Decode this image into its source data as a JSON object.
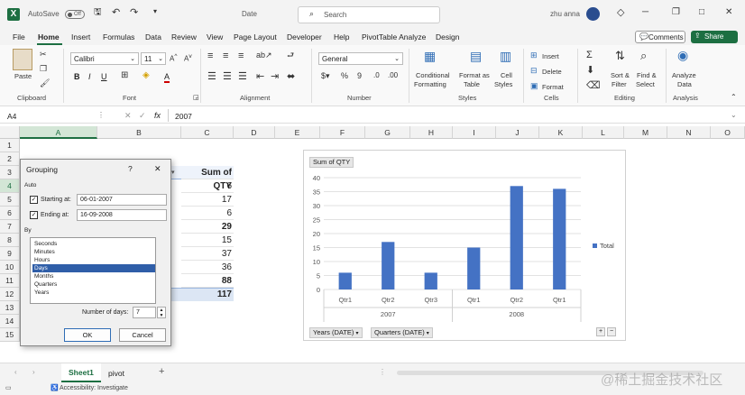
{
  "app": {
    "autosave_label": "AutoSave",
    "autosave_state": "Off",
    "file_name": "Date",
    "search_placeholder": "Search",
    "user_name": "zhu anna"
  },
  "menu": [
    "File",
    "Home",
    "Insert",
    "Formulas",
    "Data",
    "Review",
    "View",
    "Page Layout",
    "Developer",
    "Help",
    "PivotTable Analyze",
    "Design"
  ],
  "menu_active": "Home",
  "actions": {
    "comments": "Comments",
    "share": "Share"
  },
  "ribbon": {
    "clipboard": {
      "paste": "Paste",
      "label": "Clipboard"
    },
    "font": {
      "name": "Calibri",
      "size": "11",
      "label": "Font"
    },
    "alignment": {
      "label": "Alignment"
    },
    "number": {
      "format": "General",
      "label": "Number"
    },
    "styles": {
      "conditional": [
        "Conditional",
        "Formatting"
      ],
      "format_table": [
        "Format as",
        "Table"
      ],
      "cell_styles": [
        "Cell",
        "Styles"
      ],
      "label": "Styles"
    },
    "cells": {
      "insert": "Insert",
      "delete": "Delete",
      "format": "Format",
      "label": "Cells"
    },
    "editing": {
      "sort": [
        "Sort &",
        "Filter"
      ],
      "find": [
        "Find &",
        "Select"
      ],
      "label": "Editing"
    },
    "analysis": {
      "analyze": [
        "Analyze",
        "Data"
      ],
      "label": "Analysis"
    }
  },
  "formula_bar": {
    "name_box": "A4",
    "fx": "fx",
    "value": "2007"
  },
  "columns": [
    "A",
    "B",
    "C",
    "D",
    "E",
    "F",
    "G",
    "H",
    "I",
    "J",
    "K",
    "L",
    "M",
    "N",
    "O"
  ],
  "rows": [
    "1",
    "2",
    "3",
    "4",
    "5",
    "6",
    "7",
    "8",
    "9",
    "10",
    "11",
    "12",
    "13",
    "14",
    "15"
  ],
  "sheet": {
    "header_c3": "Sum of QTY",
    "col_c": [
      {
        "v": "6",
        "b": false
      },
      {
        "v": "17",
        "b": false
      },
      {
        "v": "6",
        "b": false
      },
      {
        "v": "29",
        "b": true
      },
      {
        "v": "15",
        "b": false
      },
      {
        "v": "37",
        "b": false
      },
      {
        "v": "36",
        "b": false
      },
      {
        "v": "88",
        "b": true
      },
      {
        "v": "117",
        "b": true
      }
    ]
  },
  "dialog": {
    "title": "Grouping",
    "help": "?",
    "close": "✕",
    "auto_label": "Auto",
    "starting_label": "Starting at:",
    "starting_value": "06-01-2007",
    "ending_label": "Ending at:",
    "ending_value": "16-09-2008",
    "by_label": "By",
    "by_items": [
      "Seconds",
      "Minutes",
      "Hours",
      "Days",
      "Months",
      "Quarters",
      "Years"
    ],
    "by_selected": "Days",
    "days_label": "Number of days:",
    "days_value": "7",
    "ok": "OK",
    "cancel": "Cancel"
  },
  "chart_data": {
    "type": "bar",
    "title": "Sum of QTY",
    "categories": [
      "Qtr1",
      "Qtr2",
      "Qtr3",
      "Qtr1",
      "Qtr2",
      "Qtr1"
    ],
    "groups": [
      {
        "label": "2007",
        "span": 3
      },
      {
        "label": "2008",
        "span": 3
      }
    ],
    "series": [
      {
        "name": "Total",
        "values": [
          6,
          17,
          6,
          15,
          37,
          36
        ]
      }
    ],
    "yticks": [
      0,
      5,
      10,
      15,
      20,
      25,
      30,
      35,
      40
    ],
    "ylim": [
      0,
      40
    ],
    "legend": "right",
    "bar_color": "#4472c4",
    "field_buttons": [
      "Years (DATE)",
      "Quarters (DATE)"
    ]
  },
  "tabs": {
    "sheets": [
      "Sheet1",
      "pivot"
    ],
    "active": "Sheet1",
    "add": "+"
  },
  "status": {
    "accessibility": "Accessibility: Investigate"
  },
  "watermark": "@稀土掘金技术社区"
}
